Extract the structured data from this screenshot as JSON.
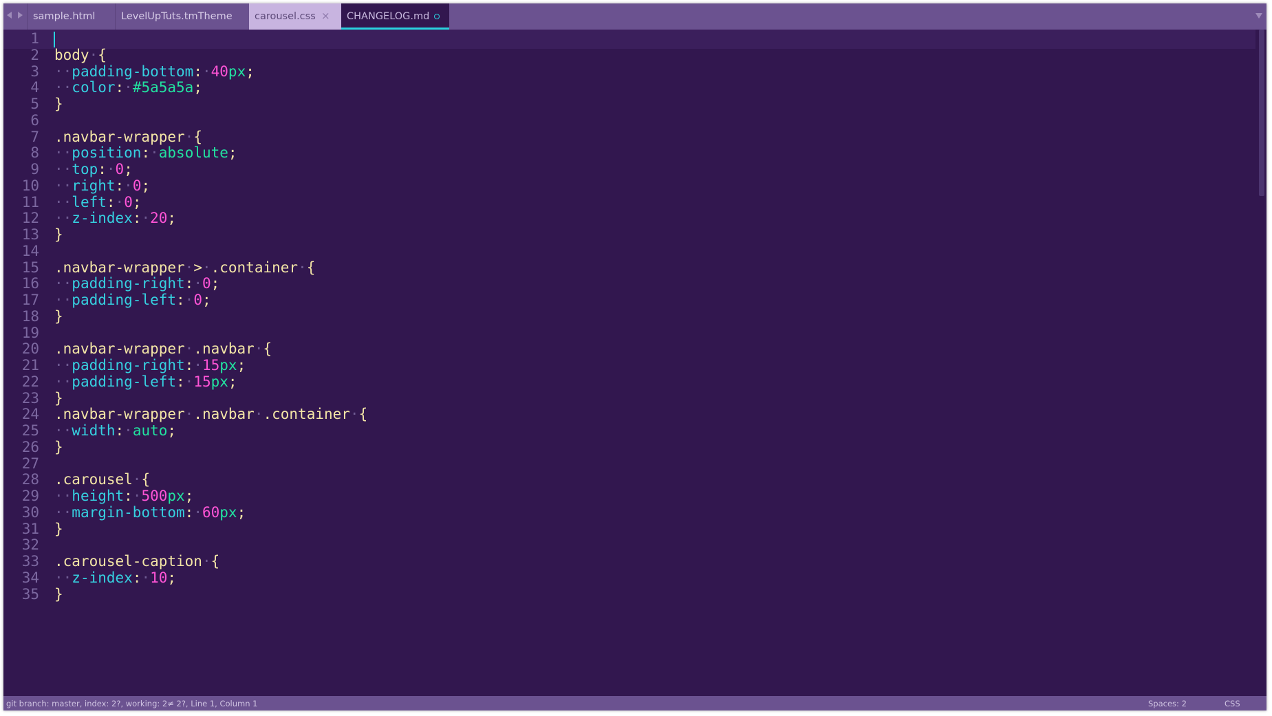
{
  "colors": {
    "background": "#32174f",
    "tabbar": "#6b5290",
    "selector": "#f3e5a6",
    "property": "#36d0e0",
    "number": "#ff54d6",
    "value": "#22e2a0",
    "accent": "#29d3df"
  },
  "tabs": [
    {
      "label": "sample.html"
    },
    {
      "label": "LevelUpTuts.tmTheme"
    },
    {
      "label": "carousel.css",
      "close_icon": "×"
    },
    {
      "label": "CHANGELOG.md",
      "dirty_icon": "circle"
    }
  ],
  "line_numbers": [
    "1",
    "2",
    "3",
    "4",
    "5",
    "6",
    "7",
    "8",
    "9",
    "10",
    "11",
    "12",
    "13",
    "14",
    "15",
    "16",
    "17",
    "18",
    "19",
    "20",
    "21",
    "22",
    "23",
    "24",
    "25",
    "26",
    "27",
    "28",
    "29",
    "30",
    "31",
    "32",
    "33",
    "34",
    "35"
  ],
  "code": [
    [],
    [
      [
        "sel",
        "body"
      ],
      [
        "ws",
        "·"
      ],
      [
        "punc",
        "{"
      ]
    ],
    [
      [
        "ws",
        "··"
      ],
      [
        "prop",
        "padding-bottom"
      ],
      [
        "punc",
        ":"
      ],
      [
        "ws",
        "·"
      ],
      [
        "num",
        "40"
      ],
      [
        "unit",
        "px"
      ],
      [
        "punc",
        ";"
      ]
    ],
    [
      [
        "ws",
        "··"
      ],
      [
        "prop",
        "color"
      ],
      [
        "punc",
        ":"
      ],
      [
        "ws",
        "·"
      ],
      [
        "val",
        "#5a5a5a"
      ],
      [
        "punc",
        ";"
      ]
    ],
    [
      [
        "punc",
        "}"
      ]
    ],
    [],
    [
      [
        "sel",
        ".navbar-wrapper"
      ],
      [
        "ws",
        "·"
      ],
      [
        "punc",
        "{"
      ]
    ],
    [
      [
        "ws",
        "··"
      ],
      [
        "prop",
        "position"
      ],
      [
        "punc",
        ":"
      ],
      [
        "ws",
        "·"
      ],
      [
        "val",
        "absolute"
      ],
      [
        "punc",
        ";"
      ]
    ],
    [
      [
        "ws",
        "··"
      ],
      [
        "prop",
        "top"
      ],
      [
        "punc",
        ":"
      ],
      [
        "ws",
        "·"
      ],
      [
        "num",
        "0"
      ],
      [
        "punc",
        ";"
      ]
    ],
    [
      [
        "ws",
        "··"
      ],
      [
        "prop",
        "right"
      ],
      [
        "punc",
        ":"
      ],
      [
        "ws",
        "·"
      ],
      [
        "num",
        "0"
      ],
      [
        "punc",
        ";"
      ]
    ],
    [
      [
        "ws",
        "··"
      ],
      [
        "prop",
        "left"
      ],
      [
        "punc",
        ":"
      ],
      [
        "ws",
        "·"
      ],
      [
        "num",
        "0"
      ],
      [
        "punc",
        ";"
      ]
    ],
    [
      [
        "ws",
        "··"
      ],
      [
        "prop",
        "z-index"
      ],
      [
        "punc",
        ":"
      ],
      [
        "ws",
        "·"
      ],
      [
        "num",
        "20"
      ],
      [
        "punc",
        ";"
      ]
    ],
    [
      [
        "punc",
        "}"
      ]
    ],
    [],
    [
      [
        "sel",
        ".navbar-wrapper"
      ],
      [
        "ws",
        "·"
      ],
      [
        "punc",
        ">"
      ],
      [
        "ws",
        "·"
      ],
      [
        "sel",
        ".container"
      ],
      [
        "ws",
        "·"
      ],
      [
        "punc",
        "{"
      ]
    ],
    [
      [
        "ws",
        "··"
      ],
      [
        "prop",
        "padding-right"
      ],
      [
        "punc",
        ":"
      ],
      [
        "ws",
        "·"
      ],
      [
        "num",
        "0"
      ],
      [
        "punc",
        ";"
      ]
    ],
    [
      [
        "ws",
        "··"
      ],
      [
        "prop",
        "padding-left"
      ],
      [
        "punc",
        ":"
      ],
      [
        "ws",
        "·"
      ],
      [
        "num",
        "0"
      ],
      [
        "punc",
        ";"
      ]
    ],
    [
      [
        "punc",
        "}"
      ]
    ],
    [],
    [
      [
        "sel",
        ".navbar-wrapper"
      ],
      [
        "ws",
        "·"
      ],
      [
        "sel",
        ".navbar"
      ],
      [
        "ws",
        "·"
      ],
      [
        "punc",
        "{"
      ]
    ],
    [
      [
        "ws",
        "··"
      ],
      [
        "prop",
        "padding-right"
      ],
      [
        "punc",
        ":"
      ],
      [
        "ws",
        "·"
      ],
      [
        "num",
        "15"
      ],
      [
        "unit",
        "px"
      ],
      [
        "punc",
        ";"
      ]
    ],
    [
      [
        "ws",
        "··"
      ],
      [
        "prop",
        "padding-left"
      ],
      [
        "punc",
        ":"
      ],
      [
        "ws",
        "·"
      ],
      [
        "num",
        "15"
      ],
      [
        "unit",
        "px"
      ],
      [
        "punc",
        ";"
      ]
    ],
    [
      [
        "punc",
        "}"
      ]
    ],
    [
      [
        "sel",
        ".navbar-wrapper"
      ],
      [
        "ws",
        "·"
      ],
      [
        "sel",
        ".navbar"
      ],
      [
        "ws",
        "·"
      ],
      [
        "sel",
        ".container"
      ],
      [
        "ws",
        "·"
      ],
      [
        "punc",
        "{"
      ]
    ],
    [
      [
        "ws",
        "··"
      ],
      [
        "prop",
        "width"
      ],
      [
        "punc",
        ":"
      ],
      [
        "ws",
        "·"
      ],
      [
        "val",
        "auto"
      ],
      [
        "punc",
        ";"
      ]
    ],
    [
      [
        "punc",
        "}"
      ]
    ],
    [],
    [
      [
        "sel",
        ".carousel"
      ],
      [
        "ws",
        "·"
      ],
      [
        "punc",
        "{"
      ]
    ],
    [
      [
        "ws",
        "··"
      ],
      [
        "prop",
        "height"
      ],
      [
        "punc",
        ":"
      ],
      [
        "ws",
        "·"
      ],
      [
        "num",
        "500"
      ],
      [
        "unit",
        "px"
      ],
      [
        "punc",
        ";"
      ]
    ],
    [
      [
        "ws",
        "··"
      ],
      [
        "prop",
        "margin-bottom"
      ],
      [
        "punc",
        ":"
      ],
      [
        "ws",
        "·"
      ],
      [
        "num",
        "60"
      ],
      [
        "unit",
        "px"
      ],
      [
        "punc",
        ";"
      ]
    ],
    [
      [
        "punc",
        "}"
      ]
    ],
    [],
    [
      [
        "sel",
        ".carousel-caption"
      ],
      [
        "ws",
        "·"
      ],
      [
        "punc",
        "{"
      ]
    ],
    [
      [
        "ws",
        "··"
      ],
      [
        "prop",
        "z-index"
      ],
      [
        "punc",
        ":"
      ],
      [
        "ws",
        "·"
      ],
      [
        "num",
        "10"
      ],
      [
        "punc",
        ";"
      ]
    ],
    [
      [
        "punc",
        "}"
      ]
    ]
  ],
  "statusbar": {
    "left": "git branch: master, index: 2?, working: 2≠ 2?, Line 1, Column 1",
    "spaces": "Spaces: 2",
    "syntax": "CSS"
  }
}
